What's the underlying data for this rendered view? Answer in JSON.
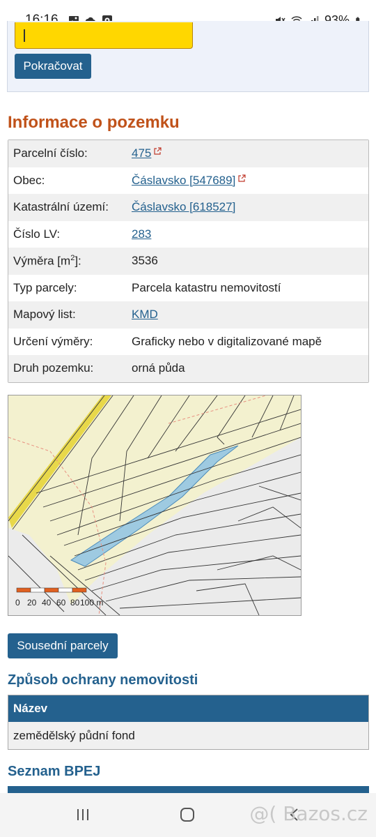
{
  "statusbar": {
    "time": "16:16",
    "battery": "93%",
    "icons_left": [
      "image-icon",
      "cloud-icon",
      "app-icon"
    ],
    "icons_right": [
      "mute-icon",
      "wifi-icon",
      "signal-icon",
      "battery-icon"
    ]
  },
  "form": {
    "continue_label": "Pokračovat"
  },
  "info": {
    "title": "Informace o pozemku",
    "rows": [
      {
        "label": "Parcelní číslo:",
        "value": "475",
        "link": true,
        "external": true
      },
      {
        "label": "Obec:",
        "value": "Čáslavsko [547689]",
        "link": true,
        "external": true
      },
      {
        "label": "Katastrální území:",
        "value": "Čáslavsko [618527]",
        "link": true,
        "external": false
      },
      {
        "label": "Číslo LV:",
        "value": "283",
        "link": true,
        "external": false
      },
      {
        "label": "Výměra [m",
        "label_sup": "2",
        "label_after": "]:",
        "value": "3536",
        "link": false,
        "external": false
      },
      {
        "label": "Typ parcely:",
        "value": "Parcela katastru nemovitostí",
        "link": false,
        "external": false
      },
      {
        "label": "Mapový list:",
        "value": "KMD",
        "link": true,
        "external": false
      },
      {
        "label": "Určení výměry:",
        "value": "Graficky nebo v digitalizované mapě",
        "link": false,
        "external": false
      },
      {
        "label": "Druh pozemku:",
        "value": "orná půda",
        "link": false,
        "external": false
      }
    ]
  },
  "map": {
    "scale_labels": [
      "0",
      "20",
      "40",
      "60",
      "80",
      "100 m"
    ]
  },
  "neighbors_label": "Sousední parcely",
  "protection": {
    "title": "Způsob ochrany nemovitosti",
    "header": "Název",
    "rows": [
      "zemědělský půdní fond"
    ]
  },
  "bpej": {
    "title": "Seznam BPEJ"
  },
  "watermark": "@( Bazos.cz",
  "colors": {
    "accent": "#24618e",
    "heading_orange": "#c0521a",
    "highlight_yellow": "#ffd700",
    "parcel_blue": "#9ecae1"
  }
}
